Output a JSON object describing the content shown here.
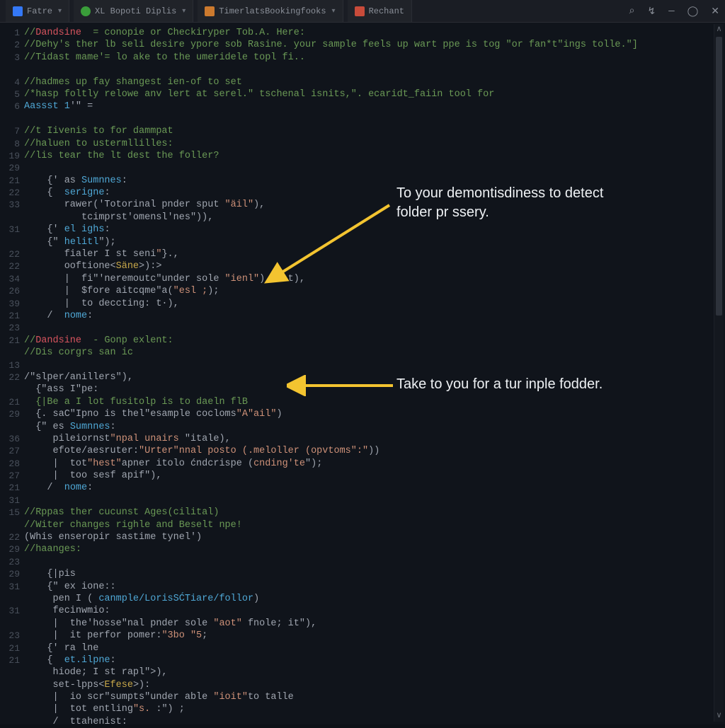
{
  "tabs": [
    {
      "label": "Fatre",
      "icon": "ico-blue"
    },
    {
      "label": "XL Bopoti Diplis",
      "icon": "ico-green"
    },
    {
      "label": "TimerlatsBookingfooks",
      "icon": "ico-orange"
    },
    {
      "label": "Rechant",
      "icon": "ico-red"
    }
  ],
  "window_controls": {
    "search": "⌕",
    "link": "↯",
    "min": "—",
    "max": "◯",
    "close": "✕"
  },
  "gutter_numbers": [
    "1",
    "2",
    "3",
    "",
    "4",
    "5",
    "6",
    "",
    "7",
    "8",
    "19",
    "29",
    "21",
    "22",
    "33",
    "",
    "31",
    "",
    "22",
    "22",
    "34",
    "26",
    "39",
    "21",
    "23",
    "21",
    "",
    "13",
    "22",
    "",
    "21",
    "29",
    "",
    "36",
    "27",
    "28",
    "27",
    "21",
    "31",
    "15",
    "",
    "22",
    "29",
    "23",
    "29",
    "31",
    "",
    "31",
    "",
    "23",
    "21",
    "21"
  ],
  "code_lines": [
    {
      "segments": [
        [
          "//",
          "c-comment"
        ],
        [
          "Dandsine",
          "c-ident"
        ],
        [
          "  = conopie or Checkiryper Tob.A. Here:",
          "c-comment"
        ]
      ]
    },
    {
      "segments": [
        [
          "//Dehy's ther lb seli desire ypore sob Rasine. your sample feels up wart ppe is tog \"or fan*t\"ings tolle.\"]",
          "c-comment"
        ]
      ]
    },
    {
      "segments": [
        [
          "//Tidast mame'= lo ake to the umeridele topl fi..",
          "c-comment"
        ]
      ]
    },
    {
      "segments": [
        [
          " ",
          "c-op"
        ]
      ]
    },
    {
      "segments": [
        [
          "//hadmes up fay shangest ien-of to set",
          "c-comment"
        ]
      ]
    },
    {
      "segments": [
        [
          "/*hasp foltly relowe anv lert at serel.\" tschenal isnits,\". ecaridt_faiin tool for",
          "c-comment"
        ]
      ]
    },
    {
      "segments": [
        [
          "Aassst ",
          "c-key"
        ],
        [
          "1",
          "c-lit"
        ],
        [
          "'\" =",
          "c-op"
        ]
      ]
    },
    {
      "segments": [
        [
          " ",
          "c-op"
        ]
      ]
    },
    {
      "segments": [
        [
          "//t Iivenis to for dammpat",
          "c-comment"
        ]
      ]
    },
    {
      "segments": [
        [
          "//haluen to ustermllilles:",
          "c-comment"
        ]
      ]
    },
    {
      "segments": [
        [
          "//lis tear the lt dest the foller?",
          "c-comment"
        ]
      ]
    },
    {
      "segments": [
        [
          " ",
          "c-op"
        ]
      ]
    },
    {
      "segments": [
        [
          "    {' as ",
          "c-op"
        ],
        [
          "Sumnnes",
          "c-key"
        ],
        [
          ":",
          "c-op"
        ]
      ]
    },
    {
      "segments": [
        [
          "    {  ",
          "c-op"
        ],
        [
          "serigne",
          "c-key"
        ],
        [
          ":",
          "c-op"
        ]
      ]
    },
    {
      "segments": [
        [
          "       rawer('Totorinal pnder sput ",
          "c-op"
        ],
        [
          "\"äil\"",
          "c-str"
        ],
        [
          "),",
          "c-op"
        ]
      ]
    },
    {
      "segments": [
        [
          "          tcimprst'omensl'nes\")),",
          "c-op"
        ]
      ]
    },
    {
      "segments": [
        [
          "    {' ",
          "c-op"
        ],
        [
          "el ighs",
          "c-key"
        ],
        [
          ":",
          "c-op"
        ]
      ]
    },
    {
      "segments": [
        [
          "    {\" ",
          "c-op"
        ],
        [
          "helitl",
          "c-key"
        ],
        [
          "\");",
          "c-op"
        ]
      ]
    },
    {
      "segments": [
        [
          "       fialer I st seni",
          "c-op"
        ],
        [
          "\"",
          "c-str"
        ],
        [
          "}.,",
          "c-op"
        ]
      ]
    },
    {
      "segments": [
        [
          "       ooftione<",
          "c-op"
        ],
        [
          "Säne",
          "c-call"
        ],
        [
          ">):>",
          "c-op"
        ]
      ]
    },
    {
      "segments": [
        [
          "       |  fi\"'neremoutc\"under sole ",
          "c-op"
        ],
        [
          "\"ienl\"",
          "c-str"
        ],
        [
          ")   :t),",
          "c-op"
        ]
      ]
    },
    {
      "segments": [
        [
          "       |  $fore aitcqme\"a(",
          "c-op"
        ],
        [
          "\"esl ;",
          "c-str"
        ],
        [
          ");",
          "c-op"
        ]
      ]
    },
    {
      "segments": [
        [
          "       |  to deccting: t·),",
          "c-op"
        ]
      ]
    },
    {
      "segments": [
        [
          "    /  ",
          "c-op"
        ],
        [
          "nome",
          "c-key"
        ],
        [
          ":",
          "c-op"
        ]
      ]
    },
    {
      "segments": [
        [
          " ",
          "c-op"
        ]
      ]
    },
    {
      "segments": [
        [
          "//",
          "c-comment"
        ],
        [
          "Dandsine",
          "c-ident"
        ],
        [
          "  - Gonp exlent:",
          "c-comment"
        ]
      ]
    },
    {
      "segments": [
        [
          "//Dis corgrs san ic",
          "c-comment"
        ]
      ]
    },
    {
      "segments": [
        [
          " ",
          "c-op"
        ]
      ]
    },
    {
      "segments": [
        [
          "/\"slper/anillers\"),",
          "c-op"
        ]
      ]
    },
    {
      "segments": [
        [
          "  {\"ass I\"pe:",
          "c-op"
        ]
      ]
    },
    {
      "segments": [
        [
          "  {|Be a I lot fusitolp is to daeln flB",
          "c-comment"
        ]
      ]
    },
    {
      "segments": [
        [
          "  {. saC\"Ipno is thel\"esample cocloms",
          "c-op"
        ],
        [
          "\"A\"ail\"",
          "c-str"
        ],
        [
          ")",
          "c-op"
        ]
      ]
    },
    {
      "segments": [
        [
          "  {\" es ",
          "c-op"
        ],
        [
          "Sumnnes",
          "c-key"
        ],
        [
          ":",
          "c-op"
        ]
      ]
    },
    {
      "segments": [
        [
          "     pileiornst",
          "c-op"
        ],
        [
          "\"npal unairs ",
          "c-str"
        ],
        [
          "\"itale",
          "c-op"
        ],
        [
          "),",
          "c-op"
        ]
      ]
    },
    {
      "segments": [
        [
          "     efote/aesruter:",
          "c-op"
        ],
        [
          "\"Urter\"nnal posto (.meloller (opvtoms\":\"",
          "c-str"
        ],
        [
          "))",
          "c-op"
        ]
      ]
    },
    {
      "segments": [
        [
          "     |  tot",
          "c-op"
        ],
        [
          "\"hest\"",
          "c-str"
        ],
        [
          "apner itolo ćndcrispe (",
          "c-op"
        ],
        [
          "cnding'te",
          "c-str"
        ],
        [
          "\");",
          "c-op"
        ]
      ]
    },
    {
      "segments": [
        [
          "     |  too sesf apif\"),",
          "c-op"
        ]
      ]
    },
    {
      "segments": [
        [
          "    /  ",
          "c-op"
        ],
        [
          "nome",
          "c-key"
        ],
        [
          ":",
          "c-op"
        ]
      ]
    },
    {
      "segments": [
        [
          " ",
          "c-op"
        ]
      ]
    },
    {
      "segments": [
        [
          "//Rppas ther cucunst Ages(cilital)",
          "c-comment"
        ]
      ]
    },
    {
      "segments": [
        [
          "//Witer changes righle and Beselt npe!",
          "c-comment"
        ]
      ]
    },
    {
      "segments": [
        [
          "(Whis enseropir sastime tynel')",
          "c-op"
        ]
      ]
    },
    {
      "segments": [
        [
          "//haanges:",
          "c-comment"
        ]
      ]
    },
    {
      "segments": [
        [
          " ",
          "c-op"
        ]
      ]
    },
    {
      "segments": [
        [
          "    {|pis",
          "c-op"
        ]
      ]
    },
    {
      "segments": [
        [
          "    {\" ex ione::",
          "c-op"
        ]
      ]
    },
    {
      "segments": [
        [
          "     pen I ( ",
          "c-op"
        ],
        [
          "canmple/LorisSĆTiare/follor",
          "c-key"
        ],
        [
          ")",
          "c-op"
        ]
      ]
    },
    {
      "segments": [
        [
          "     fecinwmio:",
          "c-op"
        ]
      ]
    },
    {
      "segments": [
        [
          "     |  the'hosse\"nal pnder sole ",
          "c-op"
        ],
        [
          "\"aot\"",
          "c-str"
        ],
        [
          " fnole; it\"),",
          "c-op"
        ]
      ]
    },
    {
      "segments": [
        [
          "     |  it perfor pomer:",
          "c-op"
        ],
        [
          "\"3bo \"5",
          "c-str"
        ],
        [
          ";",
          "c-op"
        ]
      ]
    },
    {
      "segments": [
        [
          "    {' ra lne",
          "c-op"
        ]
      ]
    },
    {
      "segments": [
        [
          "    {  ",
          "c-op"
        ],
        [
          "et.ilpne",
          "c-key"
        ],
        [
          ":",
          "c-op"
        ]
      ]
    },
    {
      "segments": [
        [
          "     hiode; I st rapl\">),",
          "c-op"
        ]
      ]
    },
    {
      "segments": [
        [
          "     set-lpps<",
          "c-op"
        ],
        [
          "Efese",
          "c-call"
        ],
        [
          ">):",
          "c-op"
        ]
      ]
    },
    {
      "segments": [
        [
          "     |  io scr\"sumpts\"under able ",
          "c-op"
        ],
        [
          "\"ioit\"",
          "c-str"
        ],
        [
          "to talle",
          "c-op"
        ]
      ]
    },
    {
      "segments": [
        [
          "     |  tot entling",
          "c-op"
        ],
        [
          "\"s. ",
          "c-str"
        ],
        [
          ":\") ;",
          "c-op"
        ]
      ]
    },
    {
      "segments": [
        [
          "     /  ttahenist:",
          "c-op"
        ]
      ]
    }
  ],
  "annotations": {
    "a1": "To your demontisdiness to detect folder pr ssery.",
    "a2": "Take to you for a tur inple fodder."
  }
}
